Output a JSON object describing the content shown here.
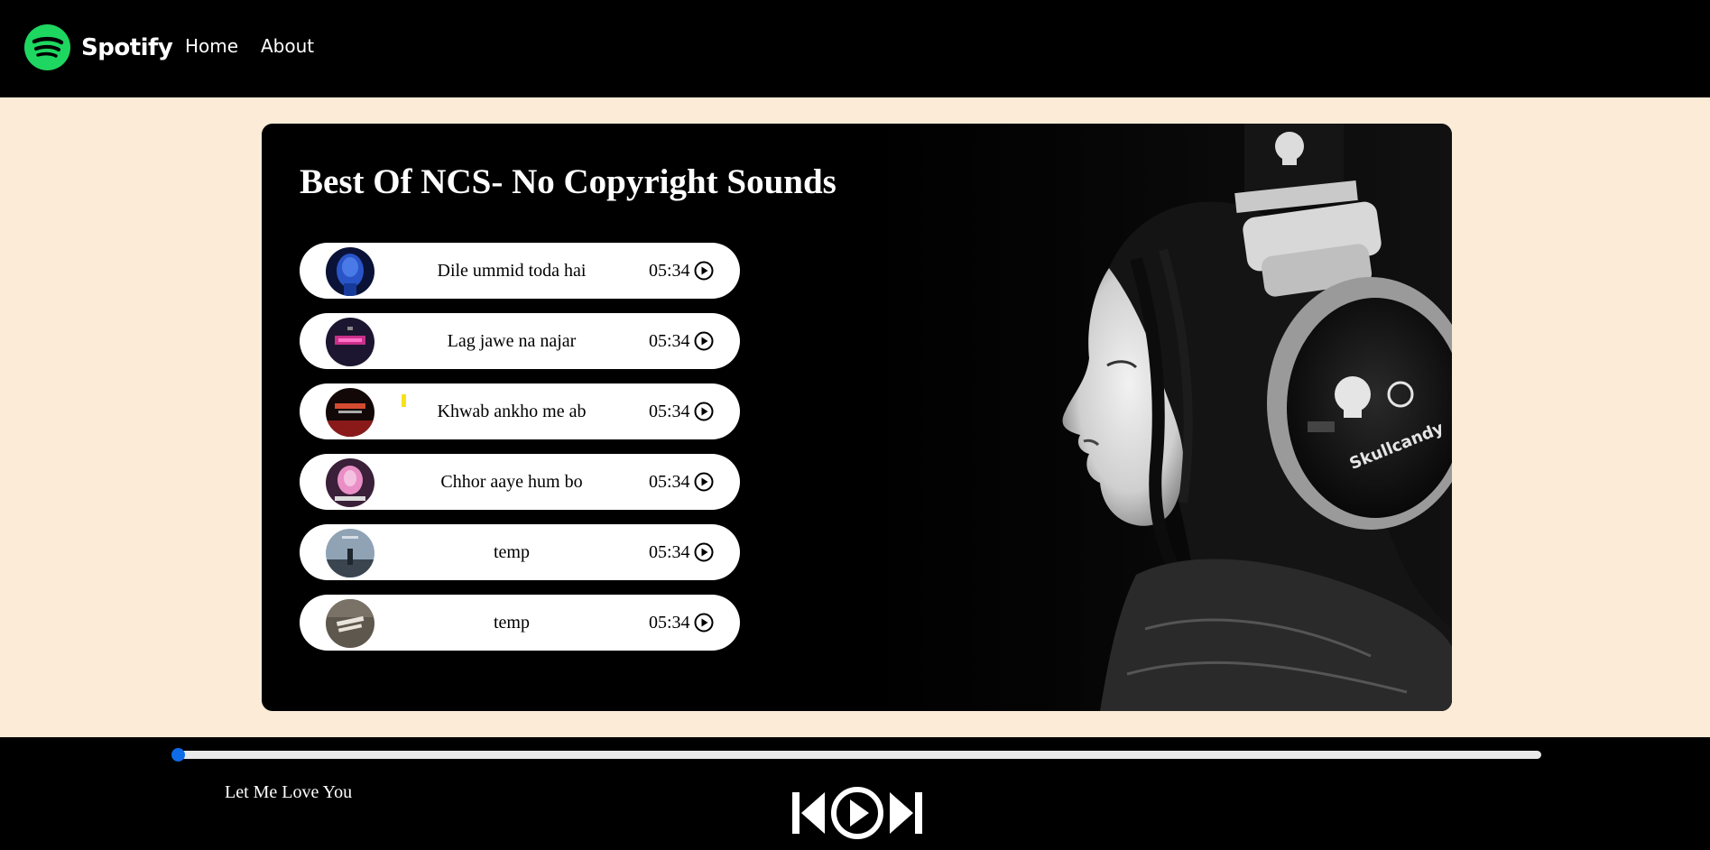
{
  "nav": {
    "brand": "Spotify",
    "links": [
      "Home",
      "About"
    ]
  },
  "playlist": {
    "title": "Best Of NCS- No Copyright Sounds",
    "songs": [
      {
        "name": "Dile ummid toda hai",
        "duration": "05:34",
        "cover_colors": [
          "#1e3fa8",
          "#0a0f3a"
        ]
      },
      {
        "name": "Lag jawe na najar",
        "duration": "05:34",
        "cover_colors": [
          "#2b1c40",
          "#c8308a"
        ]
      },
      {
        "name": "Khwab ankho me ab",
        "duration": "05:34",
        "cover_colors": [
          "#1a0d0d",
          "#c0242a"
        ]
      },
      {
        "name": "Chhor aaye hum bo",
        "duration": "05:34",
        "cover_colors": [
          "#4a2a4a",
          "#e98fc6"
        ]
      },
      {
        "name": "temp",
        "duration": "05:34",
        "cover_colors": [
          "#8fa3b5",
          "#2c3540"
        ]
      },
      {
        "name": "temp",
        "duration": "05:34",
        "cover_colors": [
          "#6a6258",
          "#2a2622"
        ]
      }
    ]
  },
  "player": {
    "current_song": "Let Me Love You",
    "progress_fraction": 0.0
  },
  "colors": {
    "accent": "#1ed760",
    "seek_thumb": "#0f6ce8",
    "page_bg": "#fbebd7"
  }
}
